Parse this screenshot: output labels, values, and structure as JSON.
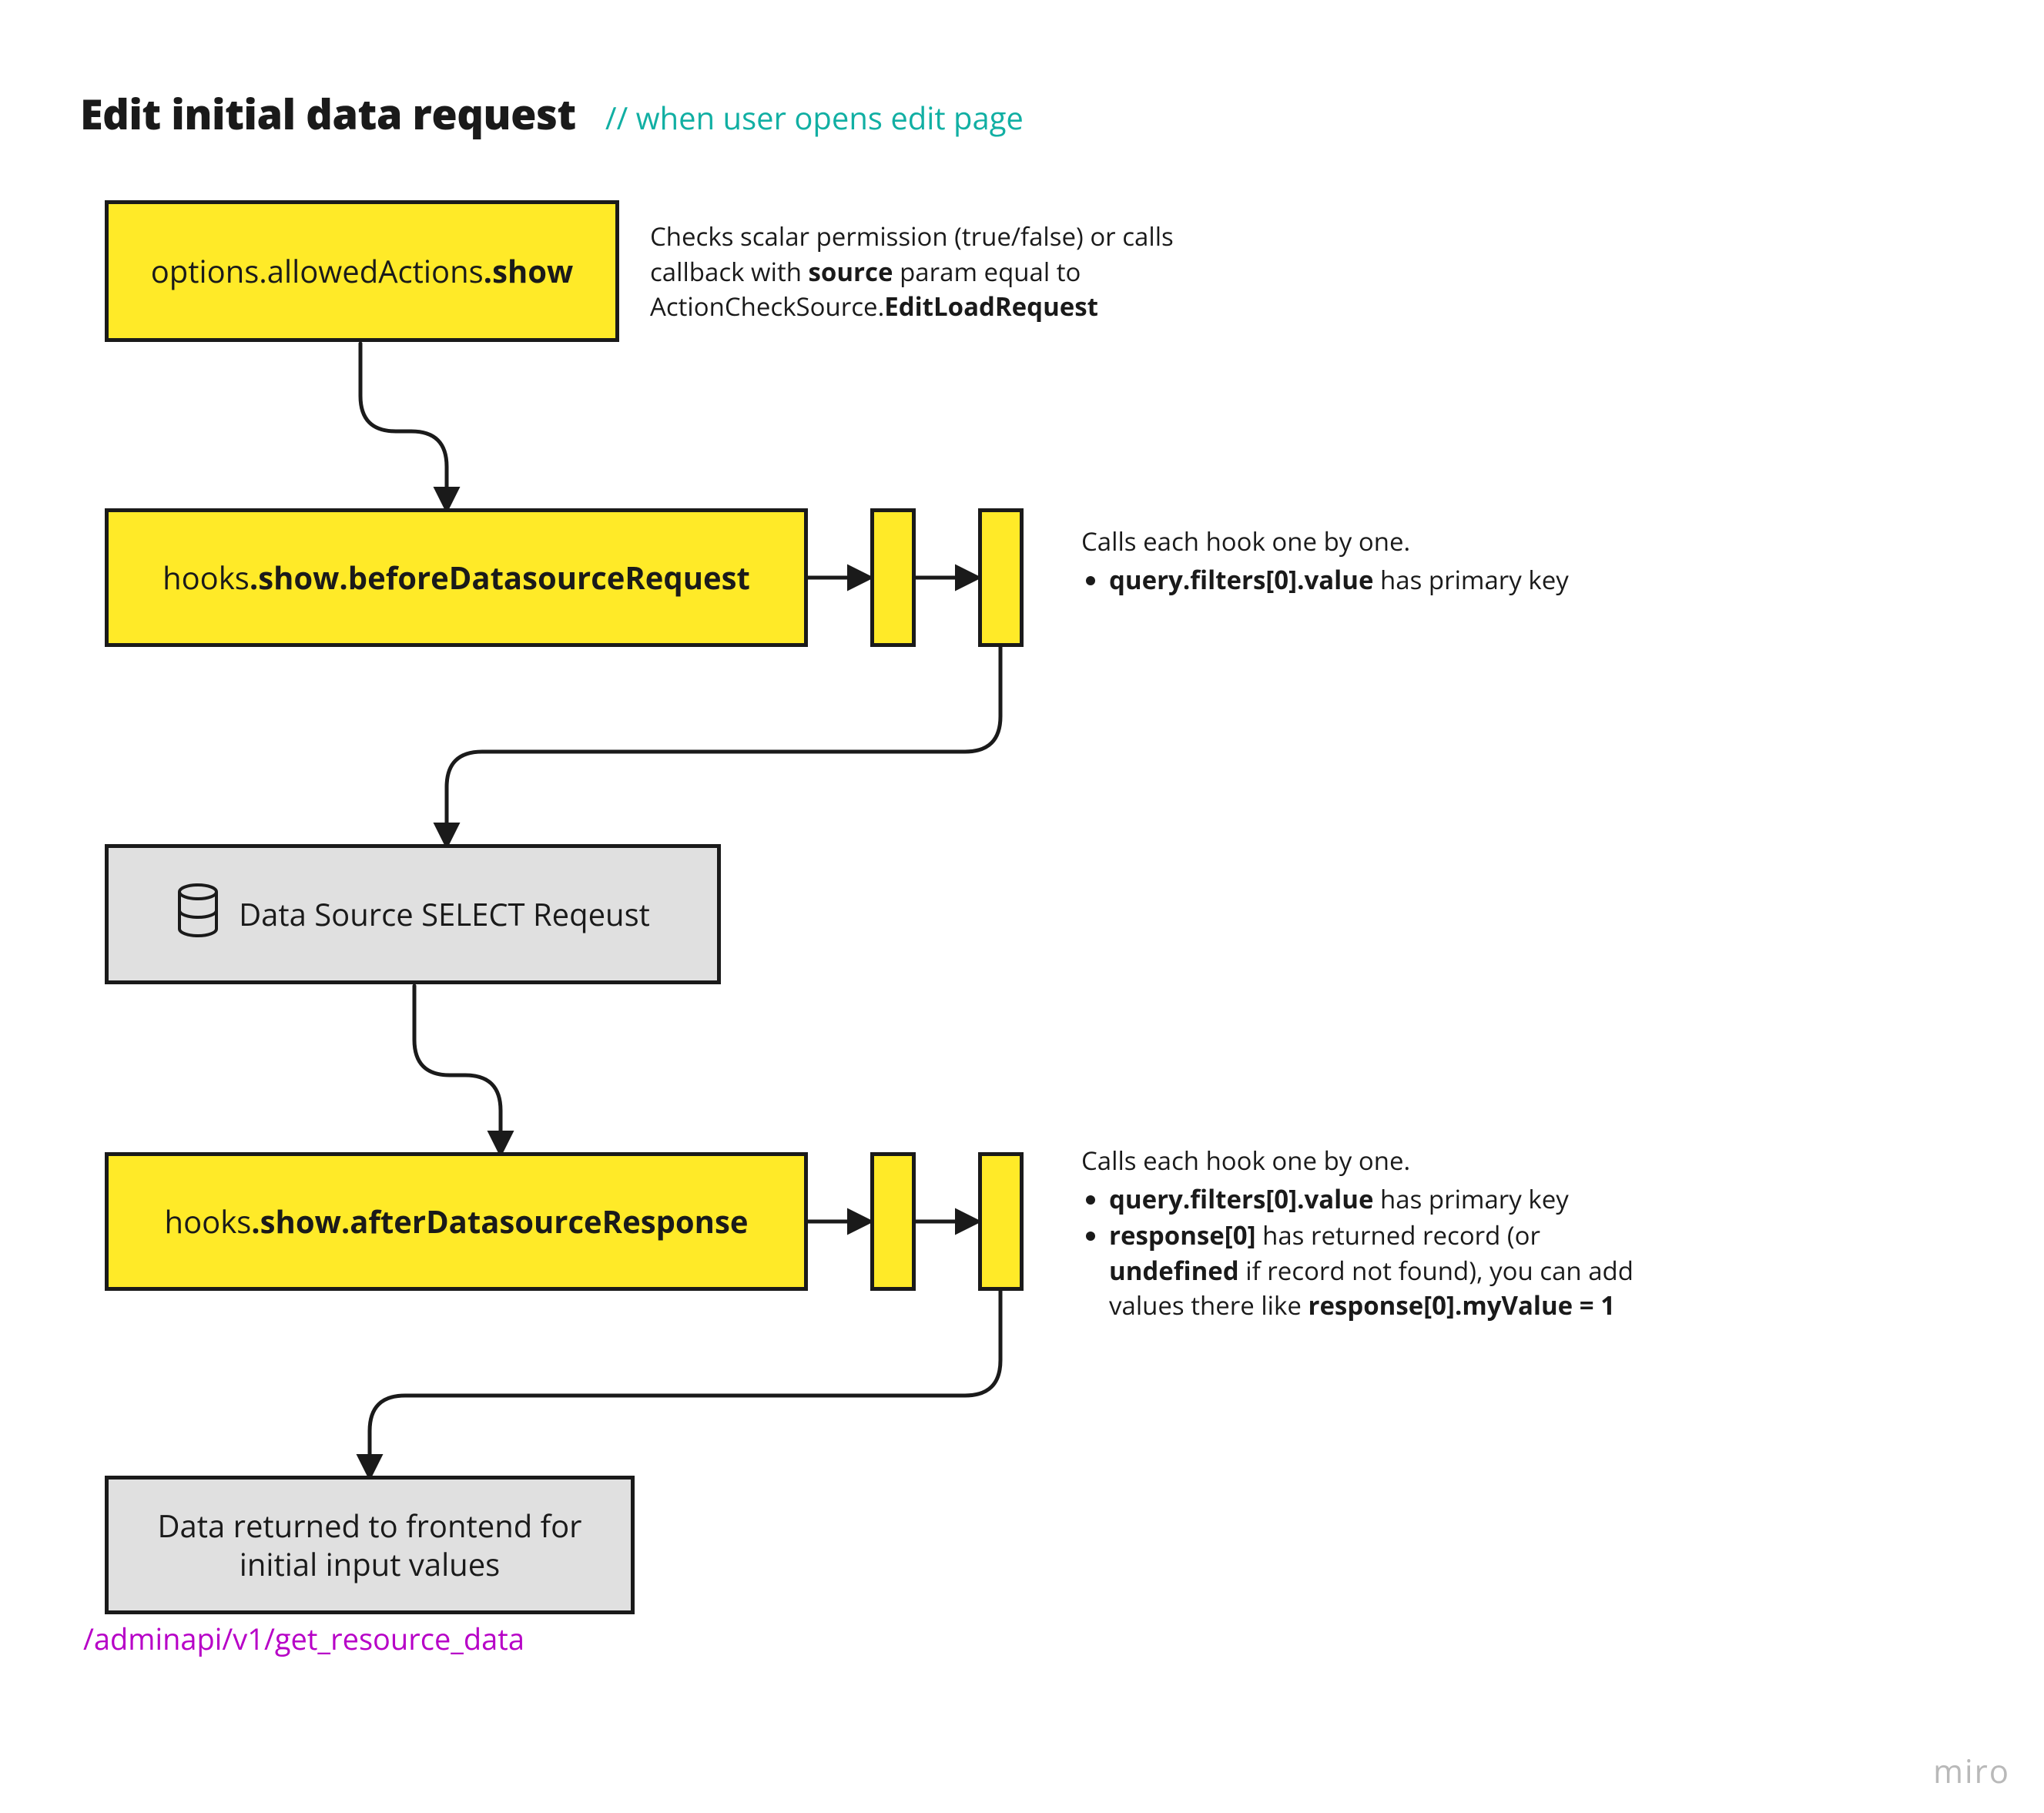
{
  "header": {
    "title": "Edit initial data request",
    "comment": "// when user opens edit page"
  },
  "nodes": {
    "allowed": {
      "pre": "options.allowedActions",
      "bold": ".show"
    },
    "beforeHook": {
      "pre": "hooks",
      "bold": ".show.beforeDatasourceRequest"
    },
    "select": "Data Source SELECT Reqeust",
    "afterHook": {
      "pre": "hooks",
      "bold": ".show.afterDatasourceResponse"
    },
    "returned": "Data returned to frontend for initial input values"
  },
  "notes": {
    "perm_pre": "Checks scalar permission (true/false) or calls callback with ",
    "perm_b1": "source",
    "perm_mid": " param equal to ActionCheckSource.",
    "perm_b2": "EditLoadRequest",
    "hookLine": "Calls each hook one by one.",
    "before_b1": "query.filters[0].value",
    "before_t1": " has primary key",
    "after_b1": "query.filters[0].value",
    "after_t1": " has primary key",
    "after_b2": "response[0]",
    "after_t2": " has returned record (or ",
    "after_b3": "undefined",
    "after_t3": " if record not found), you can add values there like ",
    "after_b4": "response[0].myValue = 1"
  },
  "endpoint": "/adminapi/v1/get_resource_data",
  "watermark": "miro"
}
